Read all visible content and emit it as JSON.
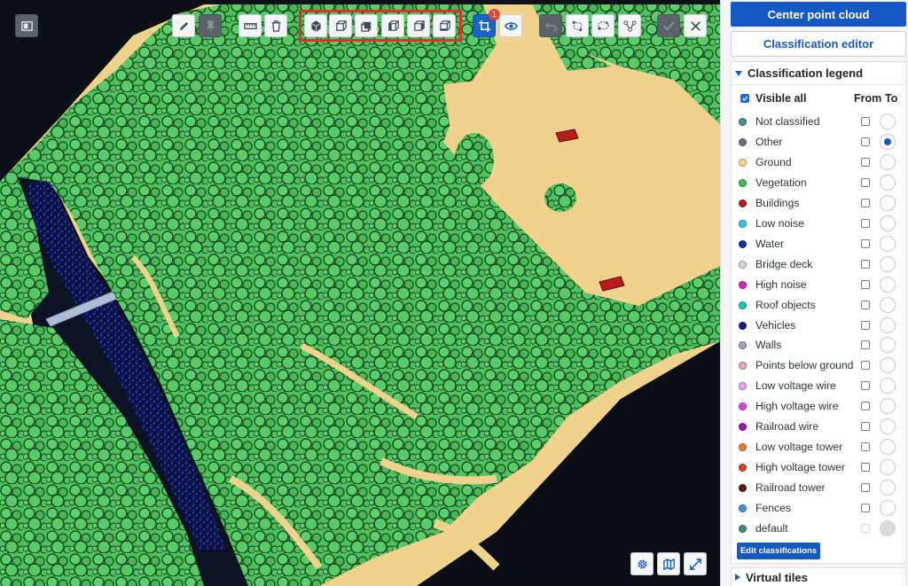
{
  "toolbar": {
    "left_icon": "panel-toggle-icon",
    "buttons": [
      {
        "name": "pencil-icon",
        "state": "normal"
      },
      {
        "name": "pin-icon",
        "state": "dim"
      },
      {
        "name": "ruler-icon",
        "state": "normal"
      },
      {
        "name": "trash-icon",
        "state": "normal"
      },
      {
        "name": "cube-view-top-icon",
        "state": "normal"
      },
      {
        "name": "cube-view-front-icon",
        "state": "normal"
      },
      {
        "name": "cube-view-back-icon",
        "state": "normal"
      },
      {
        "name": "cube-view-left-icon",
        "state": "normal"
      },
      {
        "name": "cube-view-right-icon",
        "state": "normal"
      },
      {
        "name": "cube-view-bottom-icon",
        "state": "normal"
      },
      {
        "name": "crop-icon",
        "state": "active",
        "badge": "1"
      },
      {
        "name": "eye-icon",
        "state": "normal"
      },
      {
        "name": "undo-icon",
        "state": "dim"
      },
      {
        "name": "polygon-select-icon",
        "state": "normal"
      },
      {
        "name": "lasso-select-icon",
        "state": "normal"
      },
      {
        "name": "vector-nodes-icon",
        "state": "normal"
      },
      {
        "name": "check-icon",
        "state": "dim"
      },
      {
        "name": "close-icon",
        "state": "normal"
      }
    ],
    "bottom_right": [
      "settings-gear-icon",
      "map-icon",
      "fullscreen-icon"
    ]
  },
  "panel": {
    "center_button": "Center point cloud",
    "editor_button": "Classification editor",
    "legend_title": "Classification legend",
    "visible_all": "Visible all",
    "from_label": "From",
    "to_label": "To",
    "edit_button": "Edit classifications",
    "virtual_tiles": "Virtual tiles",
    "classes": [
      {
        "name": "Not classified",
        "color": "#4c8f8f",
        "to_selected": false
      },
      {
        "name": "Other",
        "color": "#6b7180",
        "to_selected": true
      },
      {
        "name": "Ground",
        "color": "#f2d98f",
        "to_selected": false
      },
      {
        "name": "Vegetation",
        "color": "#3fbf56",
        "to_selected": false
      },
      {
        "name": "Buildings",
        "color": "#b81c1c",
        "to_selected": false
      },
      {
        "name": "Low noise",
        "color": "#28c8e8",
        "to_selected": false
      },
      {
        "name": "Water",
        "color": "#0f2fb0",
        "to_selected": false
      },
      {
        "name": "Bridge deck",
        "color": "#cdd7e6",
        "to_selected": false
      },
      {
        "name": "High noise",
        "color": "#e01fc0",
        "to_selected": false
      },
      {
        "name": "Roof objects",
        "color": "#14c9b0",
        "to_selected": false
      },
      {
        "name": "Vehicles",
        "color": "#121a8a",
        "to_selected": false
      },
      {
        "name": "Walls",
        "color": "#9aa6bd",
        "to_selected": false
      },
      {
        "name": "Points below ground",
        "color": "#f0a6b8",
        "to_selected": false
      },
      {
        "name": "Low voltage wire",
        "color": "#e7a6f0",
        "to_selected": false
      },
      {
        "name": "High voltage wire",
        "color": "#e53de8",
        "to_selected": false
      },
      {
        "name": "Railroad wire",
        "color": "#9c14b0",
        "to_selected": false
      },
      {
        "name": "Low voltage tower",
        "color": "#f07c3a",
        "to_selected": false
      },
      {
        "name": "High voltage tower",
        "color": "#d9461c",
        "to_selected": false
      },
      {
        "name": "Railroad tower",
        "color": "#5c1818",
        "to_selected": false
      },
      {
        "name": "Fences",
        "color": "#4a90e2",
        "to_selected": false
      },
      {
        "name": "default",
        "color": "#3f8a85",
        "to_selected": false,
        "disabled": true
      }
    ]
  }
}
